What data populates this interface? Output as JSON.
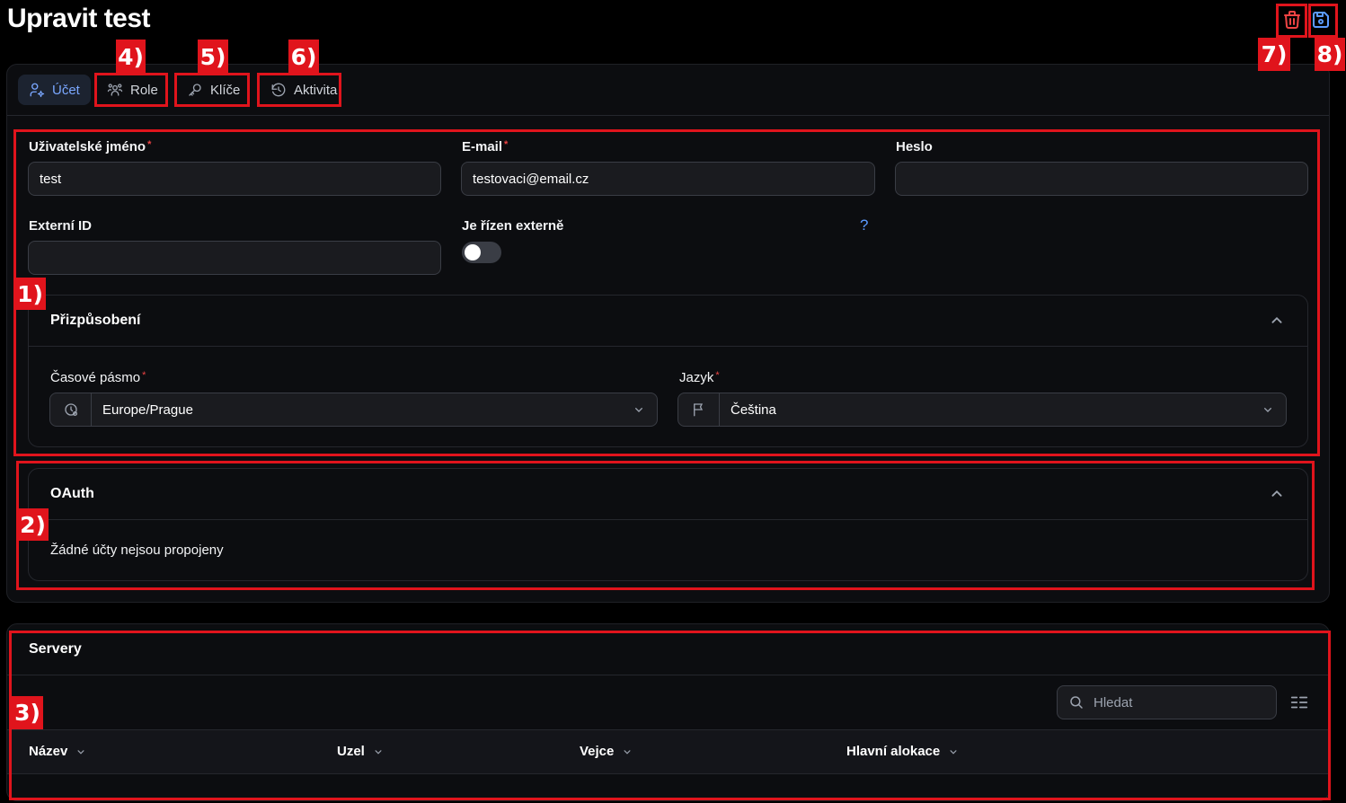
{
  "header": {
    "title": "Upravit test",
    "delete_icon": "trash-icon",
    "save_icon": "save-icon"
  },
  "tabs": [
    {
      "label": "Účet",
      "icon": "user-gear-icon",
      "active": true
    },
    {
      "label": "Role",
      "icon": "users-icon"
    },
    {
      "label": "Klíče",
      "icon": "key-icon"
    },
    {
      "label": "Aktivita",
      "icon": "history-icon"
    }
  ],
  "form": {
    "username": {
      "label": "Uživatelské jméno",
      "required": "*",
      "value": "test"
    },
    "email": {
      "label": "E-mail",
      "required": "*",
      "value": "testovaci@email.cz"
    },
    "password": {
      "label": "Heslo",
      "value": ""
    },
    "external_id": {
      "label": "Externí ID",
      "value": ""
    },
    "externally_managed": {
      "label": "Je řízen externě",
      "help": "?",
      "enabled": false
    }
  },
  "customization": {
    "title": "Přizpůsobení",
    "timezone": {
      "label": "Časové pásmo",
      "required": "*",
      "value": "Europe/Prague",
      "icon": "clock-icon"
    },
    "language": {
      "label": "Jazyk",
      "required": "*",
      "value": "Čeština",
      "icon": "flag-icon"
    }
  },
  "oauth": {
    "title": "OAuth",
    "empty_text": "Žádné účty nejsou propojeny"
  },
  "servers": {
    "title": "Servery",
    "search_placeholder": "Hledat",
    "columns": [
      "Název",
      "Uzel",
      "Vejce",
      "Hlavní alokace"
    ]
  },
  "annotations": [
    "1)",
    "2)",
    "3)",
    "4)",
    "5)",
    "6)",
    "7)",
    "8)"
  ],
  "colors": {
    "accent": "#7aa7ff",
    "danger": "#ef4444",
    "annotation": "#e0141c",
    "background": "#000000",
    "panel": "#0c0d10"
  }
}
